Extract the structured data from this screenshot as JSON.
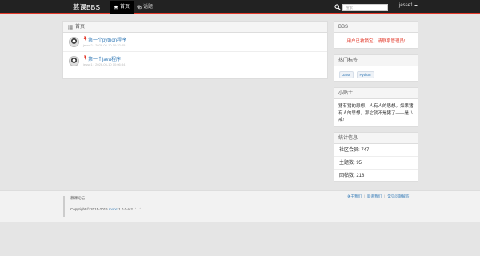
{
  "navbar": {
    "brand": "慕课BBS",
    "home_label": "首页",
    "topics_label": "话题",
    "search_placeholder": "搜索",
    "user": "jesse1"
  },
  "topics_panel": {
    "title": "首页",
    "topics": [
      {
        "title": "第一个python程序",
        "meta": "jesse2 • 2026-06-10 10:32:25"
      },
      {
        "title": "第一个java程序",
        "meta": "jesse1 • 2026-06-10 10:06:34"
      }
    ]
  },
  "bbs_panel": {
    "title": "BBS",
    "message": "用户已被锁定，请联系管理员!"
  },
  "tags_panel": {
    "title": "热门标签",
    "tags": [
      "Java",
      "Python"
    ]
  },
  "tips_panel": {
    "title": "小贴士",
    "text": "猪有猪的思想，人有人的思想。如果猪有人的思想，那它就不是猪了——是八戒!"
  },
  "stats_panel": {
    "title": "统计信息",
    "members": "社区会员: 747",
    "topics": "主题数: 95",
    "replies": "回帖数: 218"
  },
  "footer": {
    "name": "慕课论坛",
    "copyright": "Copyright © 2015-2016 ",
    "version_link": "mooc",
    "version": " 1.0.0-rc2",
    "extra": " ︰ ︰",
    "links": [
      "关于我们",
      "联系我们",
      "常见问题解答"
    ]
  },
  "colors": {
    "accent": "#e33a2b",
    "link": "#337ab7",
    "navbar": "#222222"
  }
}
